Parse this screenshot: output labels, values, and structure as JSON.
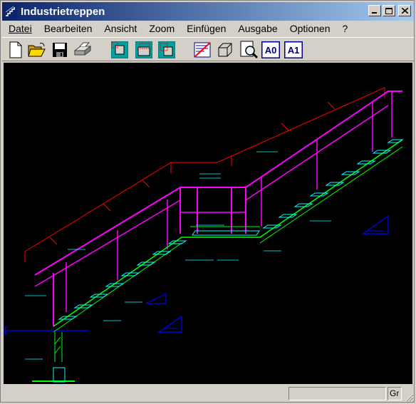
{
  "window": {
    "title": "Industrietreppen"
  },
  "menu": [
    {
      "label": "Datei"
    },
    {
      "label": "Bearbeiten"
    },
    {
      "label": "Ansicht"
    },
    {
      "label": "Zoom"
    },
    {
      "label": "Einfügen"
    },
    {
      "label": "Ausgabe"
    },
    {
      "label": "Optionen"
    },
    {
      "label": "?"
    }
  ],
  "toolbar": {
    "buttons": [
      {
        "icon": "new-file-icon"
      },
      {
        "icon": "open-folder-icon"
      },
      {
        "icon": "save-disk-icon"
      },
      {
        "icon": "print-icon"
      },
      {
        "icon": "view-select-1-icon"
      },
      {
        "icon": "view-select-2-icon"
      },
      {
        "icon": "view-select-3-icon"
      },
      {
        "icon": "crossed-drawing-icon"
      },
      {
        "icon": "3d-box-icon"
      },
      {
        "icon": "zoom-preview-icon"
      },
      {
        "icon": "format-a0-icon",
        "label": "A0"
      },
      {
        "icon": "format-a1-icon",
        "label": "A1"
      }
    ]
  },
  "statusbar": {
    "panel2": "Gr"
  },
  "drawing": {
    "description_colors": {
      "stringer": "#00ff00",
      "railing": "#ff00ff",
      "steps": "#00ffff",
      "dimension": "#ff0000",
      "markers": "#0000ff"
    }
  }
}
